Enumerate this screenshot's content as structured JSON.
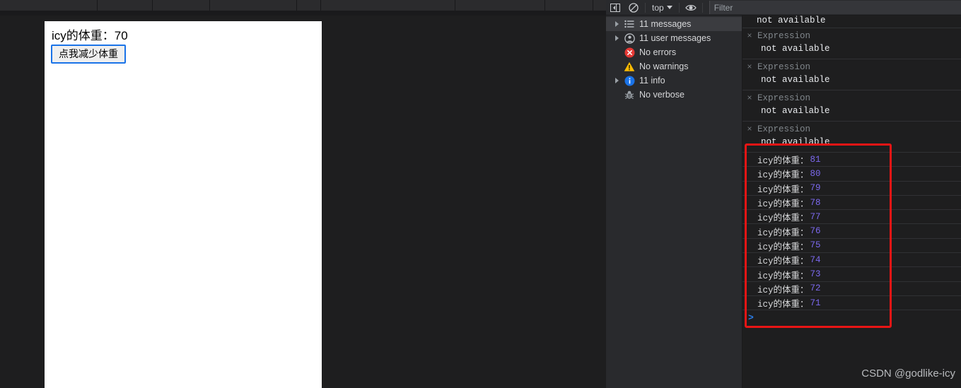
{
  "toolbar": {
    "sidebar_toggle_icon": "panel-toggle-icon",
    "clear_console_icon": "clear-console-icon",
    "context_selector": "top",
    "eye_icon": "live-expression-eye-icon",
    "filter_placeholder": "Filter",
    "filter_value": ""
  },
  "top_strip": {
    "separator_positions": [
      137,
      215,
      296,
      419,
      453,
      643,
      770,
      838
    ]
  },
  "page": {
    "weight_text": "icy的体重：70",
    "button_label": "点我减少体重"
  },
  "sidebar": {
    "items": [
      {
        "label": "11 messages",
        "icon": "list-icon",
        "expandable": true,
        "selected": true
      },
      {
        "label": "11 user messages",
        "icon": "person-icon",
        "expandable": true,
        "selected": false
      },
      {
        "label": "No errors",
        "icon": "error-icon",
        "expandable": false,
        "selected": false
      },
      {
        "label": "No warnings",
        "icon": "warning-icon",
        "expandable": false,
        "selected": false
      },
      {
        "label": "11 info",
        "icon": "info-icon",
        "expandable": true,
        "selected": false
      },
      {
        "label": "No verbose",
        "icon": "bug-icon",
        "expandable": false,
        "selected": false
      }
    ]
  },
  "console": {
    "partial_top": "not available",
    "expressions": [
      {
        "label": "Expression",
        "value": "not available"
      },
      {
        "label": "Expression",
        "value": "not available"
      },
      {
        "label": "Expression",
        "value": "not available"
      },
      {
        "label": "Expression",
        "value": "not available"
      }
    ],
    "logs": [
      {
        "text": "icy的体重：",
        "value": "81"
      },
      {
        "text": "icy的体重：",
        "value": "80"
      },
      {
        "text": "icy的体重：",
        "value": "79"
      },
      {
        "text": "icy的体重：",
        "value": "78"
      },
      {
        "text": "icy的体重：",
        "value": "77"
      },
      {
        "text": "icy的体重：",
        "value": "76"
      },
      {
        "text": "icy的体重：",
        "value": "75"
      },
      {
        "text": "icy的体重：",
        "value": "74"
      },
      {
        "text": "icy的体重：",
        "value": "73"
      },
      {
        "text": "icy的体重：",
        "value": "72"
      },
      {
        "text": "icy的体重：",
        "value": "71"
      }
    ],
    "prompt_symbol": ">"
  },
  "annotation": {
    "highlight_color": "#e81515"
  },
  "watermark": {
    "text": "CSDN @godlike-icy"
  }
}
